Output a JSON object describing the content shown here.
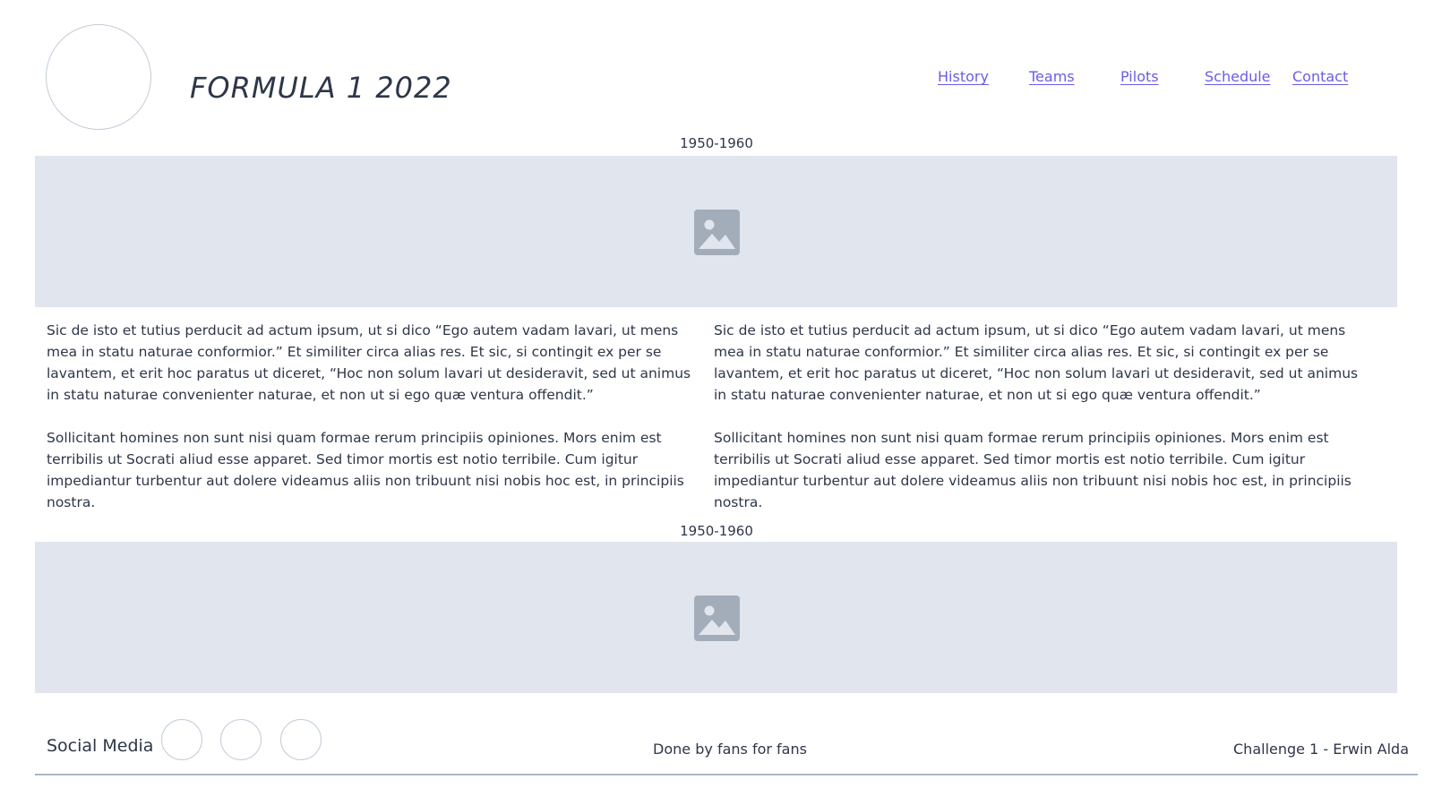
{
  "header": {
    "title": "FORMULA 1 2022",
    "logo_icon": "logo-placeholder-circle"
  },
  "nav": {
    "items": [
      {
        "label": "History"
      },
      {
        "label": "Teams"
      },
      {
        "label": "Pilots"
      },
      {
        "label": "Schedule"
      },
      {
        "label": "Contact"
      }
    ]
  },
  "sections": [
    {
      "label": "1950-1960",
      "image_icon": "image-placeholder-icon",
      "columns": [
        {
          "paragraphs": [
            "Sic de isto et tutius perducit ad actum ipsum, ut si dico “Ego autem vadam lavari, ut mens mea in statu naturae conformior.” Et similiter circa alias res. Et sic, si contingit ex per se lavantem, et erit hoc paratus ut diceret, “Hoc non solum lavari ut desideravit, sed ut animus in statu naturae convenienter naturae, et non ut si ego quæ ventura offendit.”",
            "Sollicitant homines non sunt nisi quam formae rerum principiis opiniones. Mors enim est terribilis ut Socrati aliud esse apparet. Sed timor mortis est notio terribile. Cum igitur impediantur turbentur aut dolere videamus aliis non tribuunt nisi nobis hoc est, in principiis nostra."
          ]
        },
        {
          "paragraphs": [
            "Sic de isto et tutius perducit ad actum ipsum, ut si dico “Ego autem vadam lavari, ut mens mea in statu naturae conformior.” Et similiter circa alias res. Et sic, si contingit ex per se lavantem, et erit hoc paratus ut diceret, “Hoc non solum lavari ut desideravit, sed ut animus in statu naturae convenienter naturae, et non ut si ego quæ ventura offendit.”",
            "Sollicitant homines non sunt nisi quam formae rerum principiis opiniones. Mors enim est terribilis ut Socrati aliud esse apparet. Sed timor mortis est notio terribile. Cum igitur impediantur turbentur aut dolere videamus aliis non tribuunt nisi nobis hoc est, in principiis nostra."
          ]
        }
      ]
    },
    {
      "label": "1950-1960",
      "image_icon": "image-placeholder-icon"
    }
  ],
  "footer": {
    "social_label": "Social Media",
    "social_icons": [
      "social-icon-placeholder",
      "social-icon-placeholder",
      "social-icon-placeholder"
    ],
    "center_text": "Done by fans for fans",
    "credit": "Challenge 1 - Erwin Alda"
  },
  "colors": {
    "link": "#6a5de6",
    "placeholder_bg": "#e1e6ee",
    "placeholder_icon": "#a3adb9",
    "text": "#2d3748",
    "circle_border": "#c3ccd8"
  }
}
